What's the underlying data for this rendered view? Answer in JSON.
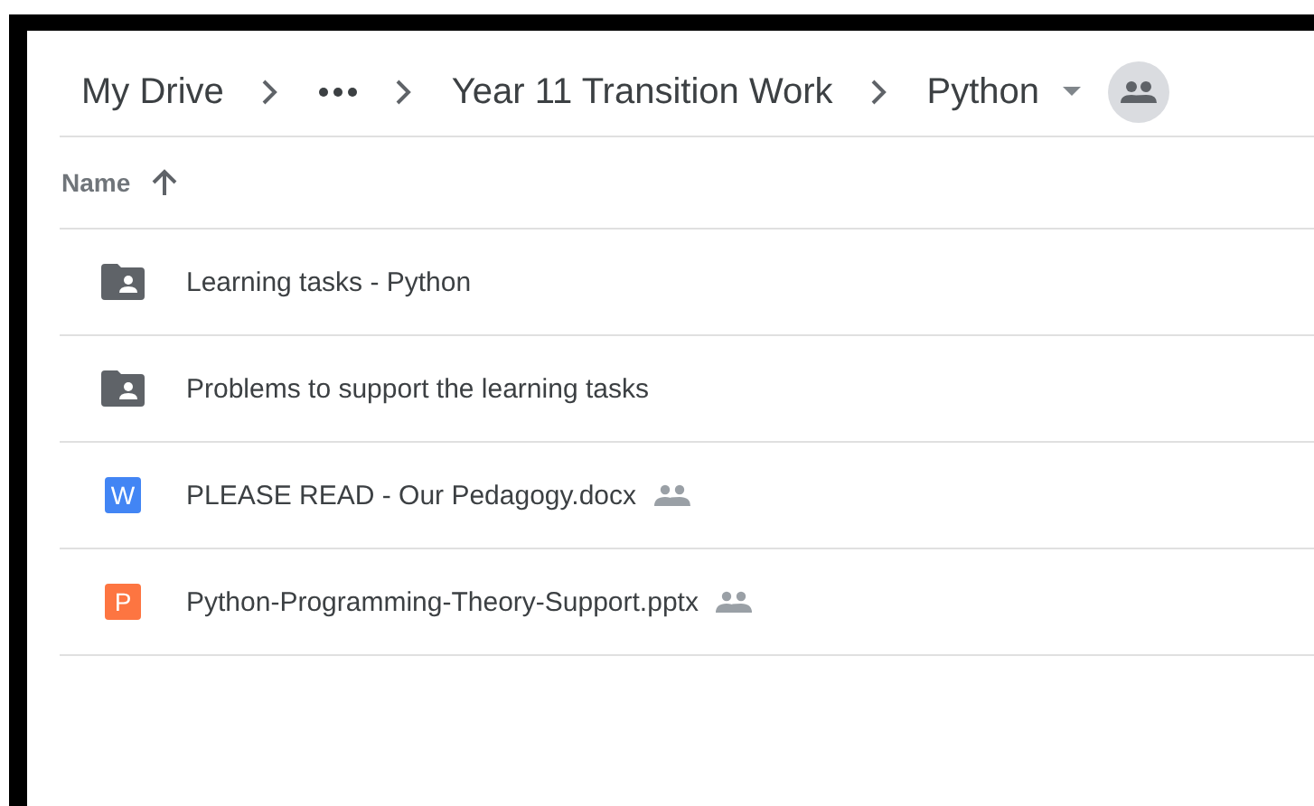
{
  "breadcrumb": [
    {
      "label": "My Drive",
      "kind": "text"
    },
    {
      "kind": "more"
    },
    {
      "label": "Year 11 Transition Work",
      "kind": "text"
    },
    {
      "label": "Python",
      "kind": "current",
      "shared": true
    }
  ],
  "table": {
    "columns": [
      {
        "label": "Name",
        "sort_ascending": true
      }
    ],
    "rows": [
      {
        "name": "Learning tasks - Python",
        "kind": "shared-folder",
        "shared": false
      },
      {
        "name": "Problems to support the learning tasks",
        "kind": "shared-folder",
        "shared": false
      },
      {
        "name": "PLEASE READ - Our Pedagogy.docx",
        "kind": "word",
        "badge": "W",
        "shared": true
      },
      {
        "name": "Python-Programming-Theory-Support.pptx",
        "kind": "powerpoint",
        "badge": "P",
        "shared": true
      }
    ]
  }
}
